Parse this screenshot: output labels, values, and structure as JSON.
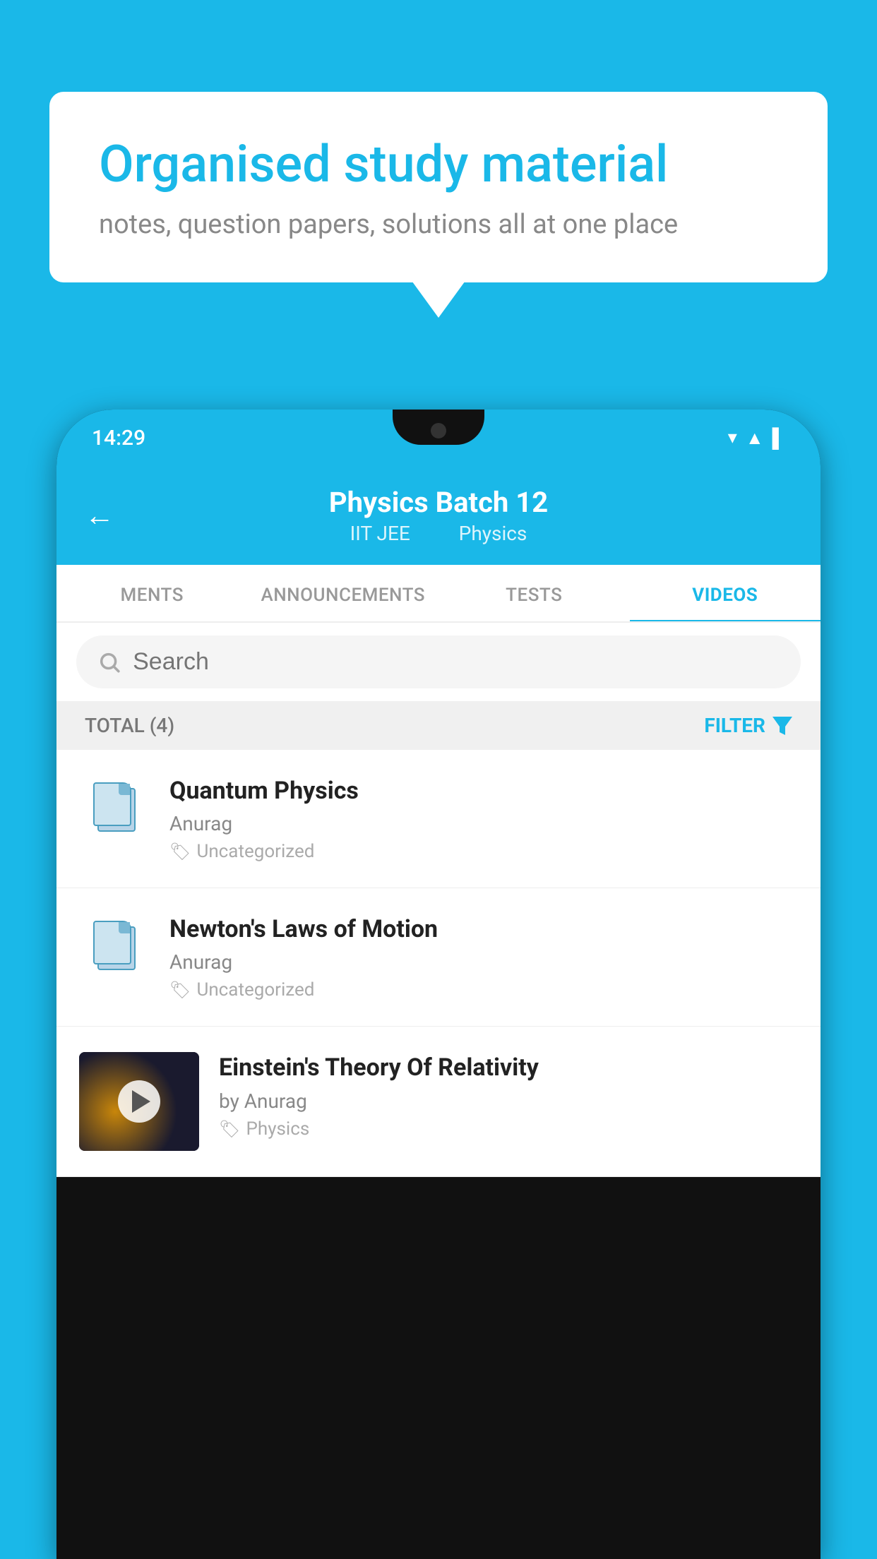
{
  "background_color": "#1ab8e8",
  "speech_bubble": {
    "title": "Organised study material",
    "subtitle": "notes, question papers, solutions all at one place"
  },
  "phone": {
    "status_bar": {
      "time": "14:29",
      "icons": [
        "wifi",
        "signal",
        "battery"
      ]
    },
    "header": {
      "back_label": "←",
      "title": "Physics Batch 12",
      "subtitle_parts": [
        "IIT JEE",
        "Physics"
      ]
    },
    "tabs": [
      {
        "label": "MENTS",
        "active": false
      },
      {
        "label": "ANNOUNCEMENTS",
        "active": false
      },
      {
        "label": "TESTS",
        "active": false
      },
      {
        "label": "VIDEOS",
        "active": true
      }
    ],
    "search": {
      "placeholder": "Search"
    },
    "filter_bar": {
      "total_label": "TOTAL (4)",
      "filter_label": "FILTER"
    },
    "video_list": [
      {
        "id": 1,
        "title": "Quantum Physics",
        "author": "Anurag",
        "tag": "Uncategorized",
        "has_thumb": false
      },
      {
        "id": 2,
        "title": "Newton's Laws of Motion",
        "author": "Anurag",
        "tag": "Uncategorized",
        "has_thumb": false
      },
      {
        "id": 3,
        "title": "Einstein's Theory Of Relativity",
        "author": "by Anurag",
        "tag": "Physics",
        "has_thumb": true
      }
    ]
  }
}
